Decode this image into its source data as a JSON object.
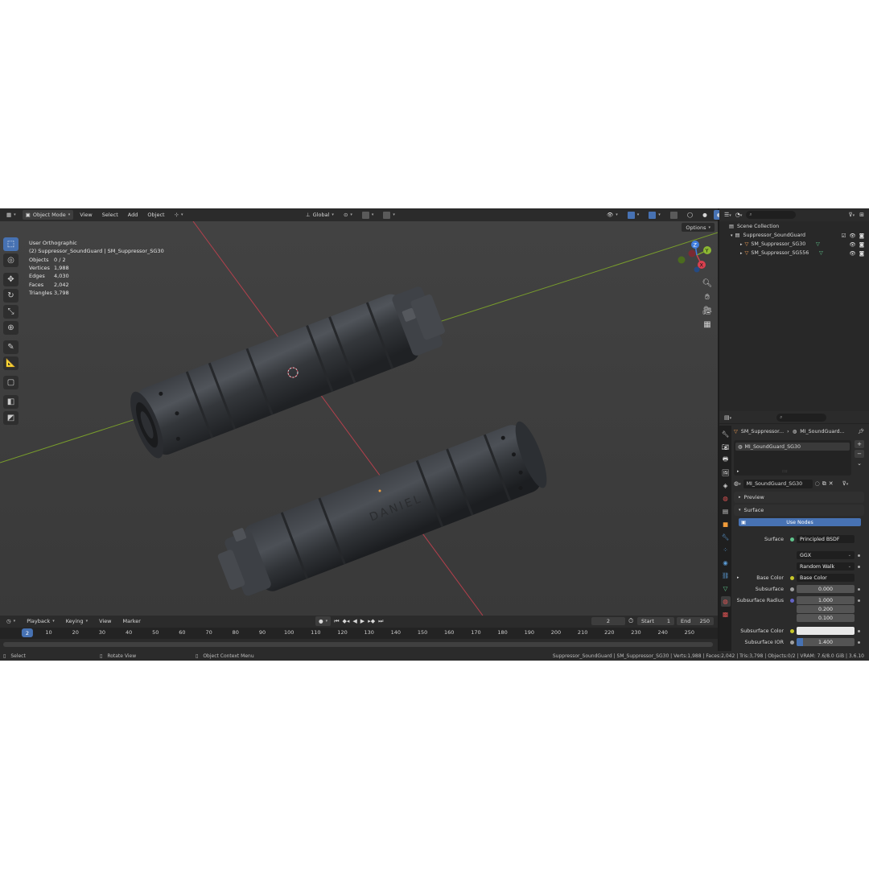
{
  "viewport_header": {
    "mode": "Object Mode",
    "menus": [
      "View",
      "Select",
      "Add",
      "Object"
    ],
    "transform_orientation": "Global"
  },
  "viewport": {
    "view_name": "User Orthographic",
    "active_object": "(2) Suppressor_SoundGuard | SM_Suppressor_SG30",
    "stats": [
      {
        "label": "Objects",
        "value": "0 / 2"
      },
      {
        "label": "Vertices",
        "value": "1,988"
      },
      {
        "label": "Edges",
        "value": "4,030"
      },
      {
        "label": "Faces",
        "value": "2,042"
      },
      {
        "label": "Triangles",
        "value": "3,798"
      }
    ],
    "options_label": "Options",
    "gizmo_axes": {
      "x": "X",
      "y": "Y",
      "z": "Z"
    },
    "engraving": "DANIEL"
  },
  "timeline": {
    "menus": [
      "Playback",
      "Keying",
      "View",
      "Marker"
    ],
    "current_frame": "2",
    "start_label": "Start",
    "start_value": "1",
    "end_label": "End",
    "end_value": "250",
    "ticks": [
      "10",
      "20",
      "30",
      "40",
      "50",
      "60",
      "70",
      "80",
      "90",
      "100",
      "110",
      "120",
      "130",
      "140",
      "150",
      "160",
      "170",
      "180",
      "190",
      "200",
      "210",
      "220",
      "230",
      "240",
      "250"
    ]
  },
  "statusbar": {
    "select": "Select",
    "rotate": "Rotate View",
    "context_menu": "Object Context Menu",
    "info": "Suppressor_SoundGuard | SM_Suppressor_SG30 | Verts:1,988 | Faces:2,042 | Tris:3,798 | Objects:0/2 | VRAM: 7.6/8.0 GiB | 3.6.10"
  },
  "outliner": {
    "root": "Scene Collection",
    "collection": "Suppressor_SoundGuard",
    "objects": [
      "SM_Suppressor_SG30",
      "SM_Suppressor_SG556"
    ]
  },
  "properties": {
    "breadcrumb_object": "SM_Suppressor...",
    "breadcrumb_material": "MI_SoundGuard...",
    "slot": "MI_SoundGuard_SG30",
    "material_name": "MI_SoundGuard_SG30",
    "preview_label": "Preview",
    "surface_panel": "Surface",
    "use_nodes": "Use Nodes",
    "surface_label": "Surface",
    "surface_value": "Principled BSDF",
    "distribution": "GGX",
    "subsurface_method": "Random Walk",
    "base_color_label": "Base Color",
    "base_color_value": "Base Color",
    "subsurface_label": "Subsurface",
    "subsurface_value": "0.000",
    "subsurface_radius_label": "Subsurface Radius",
    "subsurface_radius": [
      "1.000",
      "0.200",
      "0.100"
    ],
    "subsurface_color_label": "Subsurface Color",
    "subsurface_ior_label": "Subsurface IOR",
    "subsurface_ior_value": "1.400"
  },
  "colors": {
    "accent": "#4772b3",
    "axis_x": "#c9414f",
    "axis_y": "#7fa72a",
    "viewport_bg": "#3e3e3e"
  }
}
